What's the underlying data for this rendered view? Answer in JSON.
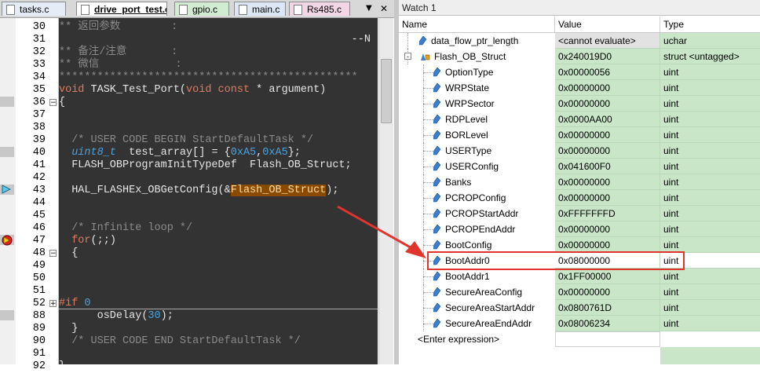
{
  "editor": {
    "tabs": [
      {
        "label": "tasks.c",
        "active": false
      },
      {
        "label": "drive_port_test.c",
        "active": true
      },
      {
        "label": "gpio.c",
        "active": false
      },
      {
        "label": "main.c",
        "active": false
      },
      {
        "label": "Rs485.c",
        "active": false
      }
    ],
    "tab_dropdown_glyph": "▼",
    "tab_close_glyph": "✕",
    "lines": [
      {
        "num": "30",
        "text": "** 返回参数        :"
      },
      {
        "num": "31",
        "text": "                                              --N"
      },
      {
        "num": "32",
        "text": "** 备注/注意       :"
      },
      {
        "num": "33",
        "text": "** 微信            :"
      },
      {
        "num": "34",
        "text": "***********************************************"
      },
      {
        "num": "35",
        "text": "void TASK_Test_Port(void const * argument)"
      },
      {
        "num": "36",
        "text": "{"
      },
      {
        "num": "37",
        "text": ""
      },
      {
        "num": "38",
        "text": ""
      },
      {
        "num": "39",
        "text": "  /* USER CODE BEGIN StartDefaultTask */"
      },
      {
        "num": "40",
        "text": "  uint8_t  test_array[] = {0xA5,0xA5};"
      },
      {
        "num": "41",
        "text": "  FLASH_OBProgramInitTypeDef  Flash_OB_Struct;"
      },
      {
        "num": "42",
        "text": ""
      },
      {
        "num": "43",
        "text": "  HAL_FLASHEx_OBGetConfig(&Flash_OB_Struct);"
      },
      {
        "num": "44",
        "text": ""
      },
      {
        "num": "45",
        "text": ""
      },
      {
        "num": "46",
        "text": "  /* Infinite loop */"
      },
      {
        "num": "47",
        "text": "  for(;;)"
      },
      {
        "num": "48",
        "text": "  {"
      },
      {
        "num": "49",
        "text": ""
      },
      {
        "num": "50",
        "text": ""
      },
      {
        "num": "51",
        "text": ""
      },
      {
        "num": "52",
        "text": "#if 0"
      },
      {
        "num": "88",
        "text": "      osDelay(30);"
      },
      {
        "num": "89",
        "text": "  }"
      },
      {
        "num": "90",
        "text": "  /* USER CODE END StartDefaultTask */"
      },
      {
        "num": "91",
        "text": ""
      },
      {
        "num": "92",
        "text": "}"
      }
    ]
  },
  "watch": {
    "title": "Watch 1",
    "columns": {
      "name": "Name",
      "value": "Value",
      "type": "Type"
    },
    "rows": [
      {
        "name": "data_flow_ptr_length",
        "value": "<cannot evaluate>",
        "type": "uchar",
        "level": 0,
        "icon": "variable-icon"
      },
      {
        "name": "Flash_OB_Struct",
        "value": "0x240019D0",
        "type": "struct <untagged>",
        "level": 0,
        "expanded": true,
        "icon": "struct-icon",
        "expander": "-"
      },
      {
        "name": "OptionType",
        "value": "0x00000056",
        "type": "uint",
        "level": 1,
        "icon": "variable-icon"
      },
      {
        "name": "WRPState",
        "value": "0x00000000",
        "type": "uint",
        "level": 1,
        "icon": "variable-icon"
      },
      {
        "name": "WRPSector",
        "value": "0x00000000",
        "type": "uint",
        "level": 1,
        "icon": "variable-icon"
      },
      {
        "name": "RDPLevel",
        "value": "0x0000AA00",
        "type": "uint",
        "level": 1,
        "icon": "variable-icon"
      },
      {
        "name": "BORLevel",
        "value": "0x00000000",
        "type": "uint",
        "level": 1,
        "icon": "variable-icon"
      },
      {
        "name": "USERType",
        "value": "0x00000000",
        "type": "uint",
        "level": 1,
        "icon": "variable-icon"
      },
      {
        "name": "USERConfig",
        "value": "0x041600F0",
        "type": "uint",
        "level": 1,
        "icon": "variable-icon"
      },
      {
        "name": "Banks",
        "value": "0x00000000",
        "type": "uint",
        "level": 1,
        "icon": "variable-icon"
      },
      {
        "name": "PCROPConfig",
        "value": "0x00000000",
        "type": "uint",
        "level": 1,
        "icon": "variable-icon"
      },
      {
        "name": "PCROPStartAddr",
        "value": "0xFFFFFFFD",
        "type": "uint",
        "level": 1,
        "icon": "variable-icon"
      },
      {
        "name": "PCROPEndAddr",
        "value": "0x00000000",
        "type": "uint",
        "level": 1,
        "icon": "variable-icon"
      },
      {
        "name": "BootConfig",
        "value": "0x00000000",
        "type": "uint",
        "level": 1,
        "icon": "variable-icon"
      },
      {
        "name": "BootAddr0",
        "value": "0x08000000",
        "type": "uint",
        "level": 1,
        "icon": "variable-icon",
        "highlight": true
      },
      {
        "name": "BootAddr1",
        "value": "0x1FF00000",
        "type": "uint",
        "level": 1,
        "icon": "variable-icon"
      },
      {
        "name": "SecureAreaConfig",
        "value": "0x00000000",
        "type": "uint",
        "level": 1,
        "icon": "variable-icon"
      },
      {
        "name": "SecureAreaStartAddr",
        "value": "0x0800761D",
        "type": "uint",
        "level": 1,
        "icon": "variable-icon"
      },
      {
        "name": "SecureAreaEndAddr",
        "value": "0x08006234",
        "type": "uint",
        "level": 1,
        "icon": "variable-icon"
      }
    ],
    "enter_expression": "<Enter expression>"
  },
  "colors": {
    "annotation_red": "#e0342d",
    "value_green": "#c9e6c9",
    "code_bg": "#333333"
  }
}
